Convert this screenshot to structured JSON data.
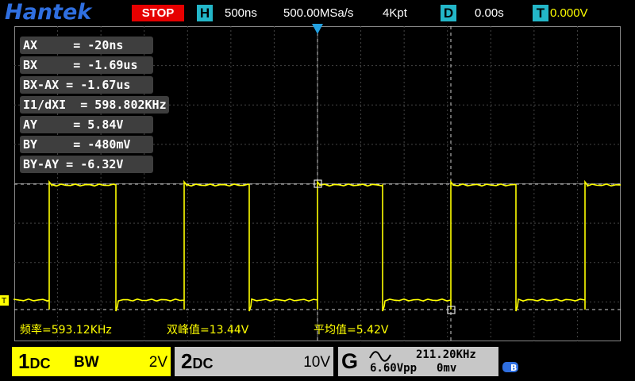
{
  "header": {
    "brand": "Hantek",
    "run_state": "STOP",
    "timebase_badge": "H",
    "timebase": "500ns",
    "sample_rate": "500.00MSa/s",
    "memory_depth": "4Kpt",
    "delay_badge": "D",
    "delay": "0.00s",
    "trigger_badge": "T",
    "trigger_level": "0.000V"
  },
  "measurements": [
    "AX     = -20ns",
    "BX     = -1.69us",
    "BX-AX = -1.67us",
    "I1/dXI  = 598.802KHz",
    "AY     = 5.84V",
    "BY     = -480mV",
    "BY-AY = -6.32V"
  ],
  "stats": {
    "frequency": "频率=593.12KHz",
    "peak_to_peak": "双峰值=13.44V",
    "average": "平均值=5.42V"
  },
  "channels": {
    "ch1": {
      "name": "1",
      "coupling": "DC",
      "bw": "BW",
      "scale": "2V"
    },
    "ch2": {
      "name": "2",
      "coupling": "DC",
      "scale": "10V"
    }
  },
  "trigger_status": {
    "source": "G",
    "frequency": "211.20KHz",
    "vpp": "6.60Vpp",
    "offset": "0mv"
  },
  "markers": {
    "trigger_marker": "T"
  },
  "colors": {
    "ch1": "#ffff00",
    "cursor": "#e0e0e0",
    "accent": "#23b6c8",
    "stop": "#e60000",
    "brand": "#2f6fe0"
  },
  "waveform": {
    "high_level_v": 5.84,
    "low_level_v": 0,
    "frequency_khz": 593.12
  }
}
